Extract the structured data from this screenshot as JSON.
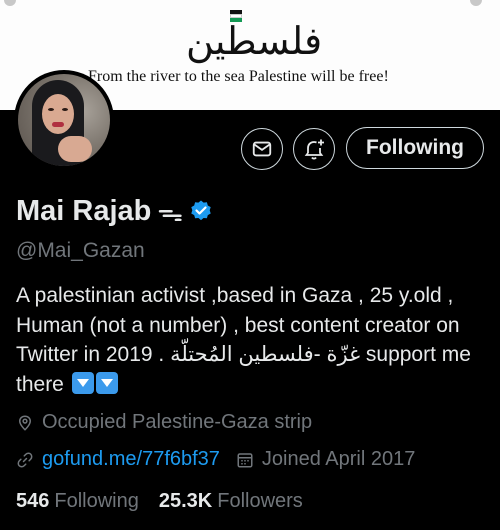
{
  "banner": {
    "arabic_title": "فلسطين",
    "slogan": "From the river to the sea Palestine will be free!"
  },
  "actions": {
    "following_label": "Following"
  },
  "profile": {
    "name": "Mai Rajab",
    "name_symbol": "ᯓ",
    "handle": "@Mai_Gazan",
    "bio_line1": "A palestinian activist ,based in Gaza , 25 y.old ,",
    "bio_line2": "Human (not a number) , best content creator on",
    "bio_line3": "Twitter in 2019 . غزّة -فلسطين المُحتلّة support me",
    "bio_line4": "there",
    "location": "Occupied Palestine-Gaza strip",
    "link": "gofund.me/77f6bf37",
    "joined": "Joined April 2017"
  },
  "stats": {
    "following_count": "546",
    "following_label": "Following",
    "followers_count": "25.3K",
    "followers_label": "Followers"
  },
  "icons": [
    "message-icon",
    "notification-bell-add-icon",
    "verified-badge-icon",
    "location-icon",
    "link-icon",
    "calendar-icon",
    "down-arrow-emoji-icon"
  ],
  "colors": {
    "background": "#000000",
    "text": "#e7e9ea",
    "muted": "#71767b",
    "accent": "#1d9bf0",
    "banner": "#fdfdfd"
  }
}
